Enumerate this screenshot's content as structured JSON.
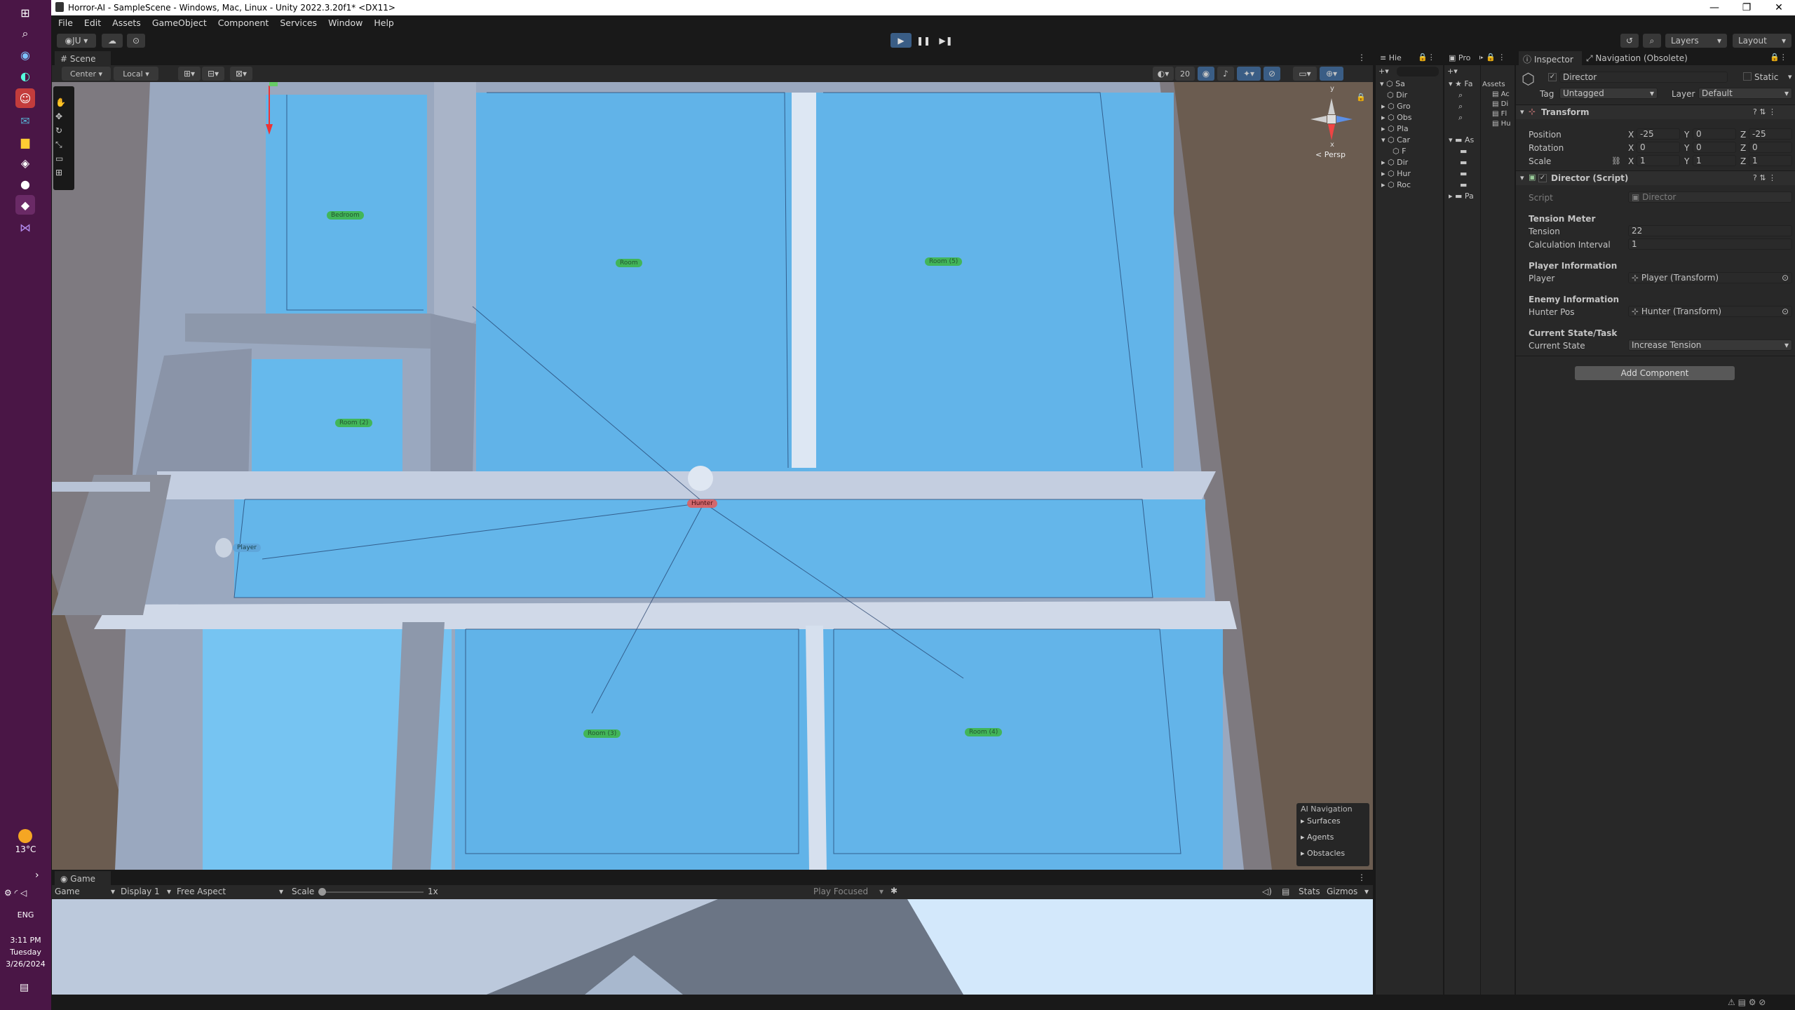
{
  "window": {
    "title": "Horror-AI - SampleScene - Windows, Mac, Linux - Unity 2022.3.20f1* <DX11>"
  },
  "menu": [
    "File",
    "Edit",
    "Assets",
    "GameObject",
    "Component",
    "Services",
    "Window",
    "Help"
  ],
  "toolbar": {
    "account": "JU",
    "layers": "Layers",
    "layout": "Layout"
  },
  "scene": {
    "tab": "Scene",
    "pivot": "Center",
    "space": "Local",
    "grid_size": "20",
    "persp_label": "< Persp",
    "axis_y": "y",
    "axis_x": "x",
    "room_labels": [
      "Bedroom",
      "Room",
      "Room (5)",
      "Room (2)",
      "Room (3)",
      "Room (4)"
    ],
    "player_label": "Player",
    "hunter_label": "Hunter",
    "ai_nav": {
      "title": "AI Navigation",
      "items": [
        "Surfaces",
        "Agents",
        "Obstacles"
      ]
    }
  },
  "game": {
    "tab": "Game",
    "view": "Game",
    "display": "Display 1",
    "aspect": "Free Aspect",
    "scale_label": "Scale",
    "scale_value": "1x",
    "play_focused": "Play Focused",
    "stats": "Stats",
    "gizmos": "Gizmos"
  },
  "hierarchy": {
    "tab": "Hie",
    "root": "Sa",
    "items": [
      "Dir",
      "Gro",
      "Obs",
      "Pla",
      "Car",
      "F",
      "Dir",
      "Hur",
      "Roc"
    ]
  },
  "project": {
    "tab": "Pro",
    "root": "Fa",
    "items": [
      "As",
      "Pa"
    ],
    "assets_label": "Assets",
    "assets": [
      "Ac",
      "Di",
      "Fl",
      "Hu"
    ]
  },
  "inspector": {
    "tab": "Inspector",
    "nav_tab": "Navigation (Obsolete)",
    "object_name": "Director",
    "static_label": "Static",
    "tag_label": "Tag",
    "tag_value": "Untagged",
    "layer_label": "Layer",
    "layer_value": "Default",
    "transform": {
      "title": "Transform",
      "position_label": "Position",
      "position": {
        "x": "-25",
        "y": "0",
        "z": "-25"
      },
      "rotation_label": "Rotation",
      "rotation": {
        "x": "0",
        "y": "0",
        "z": "0"
      },
      "scale_label": "Scale",
      "scale": {
        "x": "1",
        "y": "1",
        "z": "1"
      }
    },
    "script": {
      "title": "Director (Script)",
      "script_label": "Script",
      "script_value": "Director",
      "tension_header": "Tension Meter",
      "tension_label": "Tension",
      "tension_value": "22",
      "calc_label": "Calculation Interval",
      "calc_value": "1",
      "player_header": "Player Information",
      "player_label": "Player",
      "player_value": "Player (Transform)",
      "enemy_header": "Enemy Information",
      "hunter_label": "Hunter Pos",
      "hunter_value": "Hunter (Transform)",
      "state_header": "Current State/Task",
      "state_label": "Current State",
      "state_value": "Increase Tension"
    },
    "add_component": "Add Component"
  },
  "system": {
    "temp": "13°C",
    "lang": "ENG",
    "time": "3:11 PM",
    "day": "Tuesday",
    "date": "3/26/2024"
  }
}
